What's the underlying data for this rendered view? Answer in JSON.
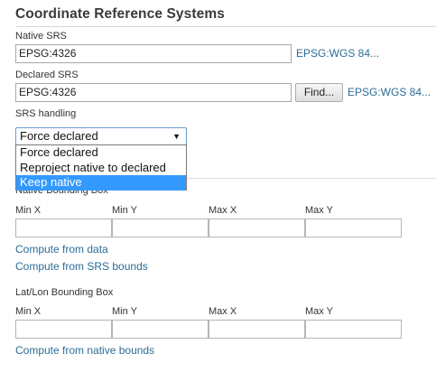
{
  "section": {
    "title": "Coordinate Reference Systems"
  },
  "native_srs": {
    "label": "Native SRS",
    "value": "EPSG:4326",
    "link": "EPSG:WGS 84..."
  },
  "declared_srs": {
    "label": "Declared SRS",
    "value": "EPSG:4326",
    "find_label": "Find...",
    "link": "EPSG:WGS 84..."
  },
  "srs_handling": {
    "label": "SRS handling",
    "selected": "Force declared",
    "arrow_icon": "triangle-down-icon",
    "options": [
      "Force declared",
      "Reproject native to declared",
      "Keep native"
    ],
    "highlighted_option": "Keep native"
  },
  "native_bbox": {
    "label": "Native Bounding Box",
    "columns": [
      "Min X",
      "Min Y",
      "Max X",
      "Max Y"
    ],
    "values": [
      "",
      "",
      "",
      ""
    ],
    "compute_from_data": "Compute from data",
    "compute_from_srs": "Compute from SRS bounds"
  },
  "latlon_bbox": {
    "label": "Lat/Lon Bounding Box",
    "columns": [
      "Min X",
      "Min Y",
      "Max X",
      "Max Y"
    ],
    "values": [
      "",
      "",
      "",
      ""
    ],
    "compute_from_native": "Compute from native bounds"
  },
  "colors": {
    "link": "#2b6d96",
    "selection": "#3399ff",
    "select_border": "#6b9bd1"
  }
}
